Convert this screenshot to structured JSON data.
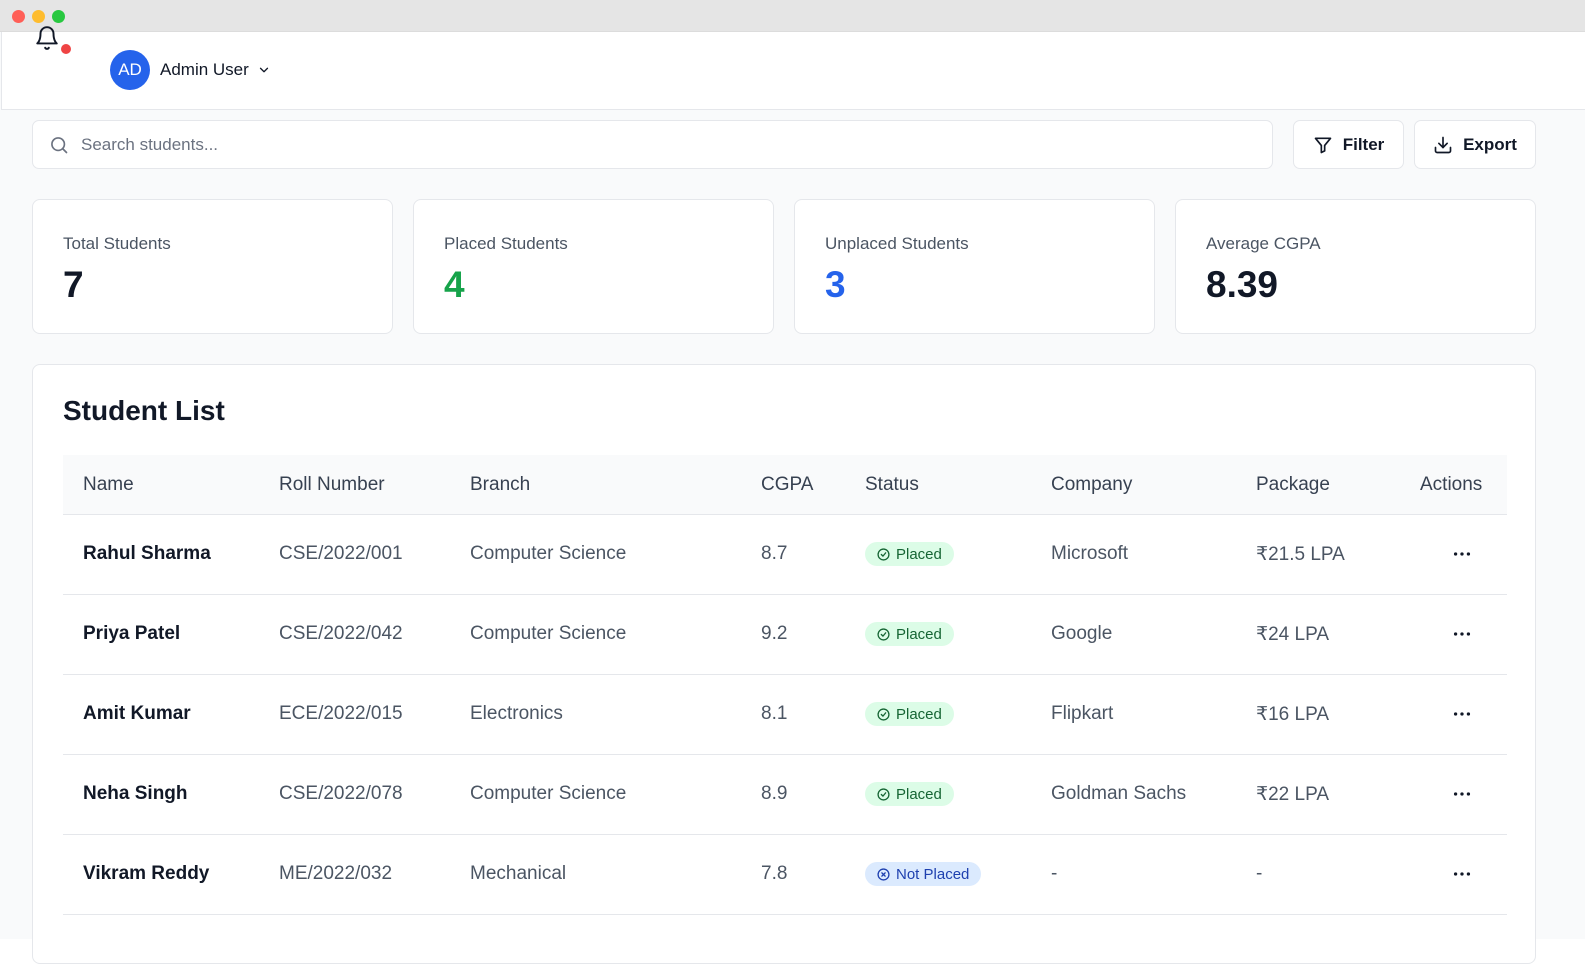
{
  "header": {
    "notification_icon": "bell-icon",
    "user": {
      "initials": "AD",
      "name": "Admin User"
    },
    "colors": {
      "avatar": "#2563eb",
      "notification_dot": "#ef4444"
    }
  },
  "toolbar": {
    "search_placeholder": "Search students...",
    "filter_label": "Filter",
    "export_label": "Export"
  },
  "stats": [
    {
      "label": "Total Students",
      "value": "7",
      "color": "#111827"
    },
    {
      "label": "Placed Students",
      "value": "4",
      "color": "#16a34a"
    },
    {
      "label": "Unplaced Students",
      "value": "3",
      "color": "#2563eb"
    },
    {
      "label": "Average CGPA",
      "value": "8.39",
      "color": "#111827"
    }
  ],
  "student_list": {
    "title": "Student List",
    "columns": [
      "Name",
      "Roll Number",
      "Branch",
      "CGPA",
      "Status",
      "Company",
      "Package",
      "Actions"
    ],
    "rows": [
      {
        "name": "Rahul Sharma",
        "roll": "CSE/2022/001",
        "branch": "Computer Science",
        "cgpa": "8.7",
        "status": "Placed",
        "company": "Microsoft",
        "package": "₹21.5 LPA"
      },
      {
        "name": "Priya Patel",
        "roll": "CSE/2022/042",
        "branch": "Computer Science",
        "cgpa": "9.2",
        "status": "Placed",
        "company": "Google",
        "package": "₹24 LPA"
      },
      {
        "name": "Amit Kumar",
        "roll": "ECE/2022/015",
        "branch": "Electronics",
        "cgpa": "8.1",
        "status": "Placed",
        "company": "Flipkart",
        "package": "₹16 LPA"
      },
      {
        "name": "Neha Singh",
        "roll": "CSE/2022/078",
        "branch": "Computer Science",
        "cgpa": "8.9",
        "status": "Placed",
        "company": "Goldman Sachs",
        "package": "₹22 LPA"
      },
      {
        "name": "Vikram Reddy",
        "roll": "ME/2022/032",
        "branch": "Mechanical",
        "cgpa": "7.8",
        "status": "Not Placed",
        "company": "-",
        "package": "-"
      }
    ]
  }
}
